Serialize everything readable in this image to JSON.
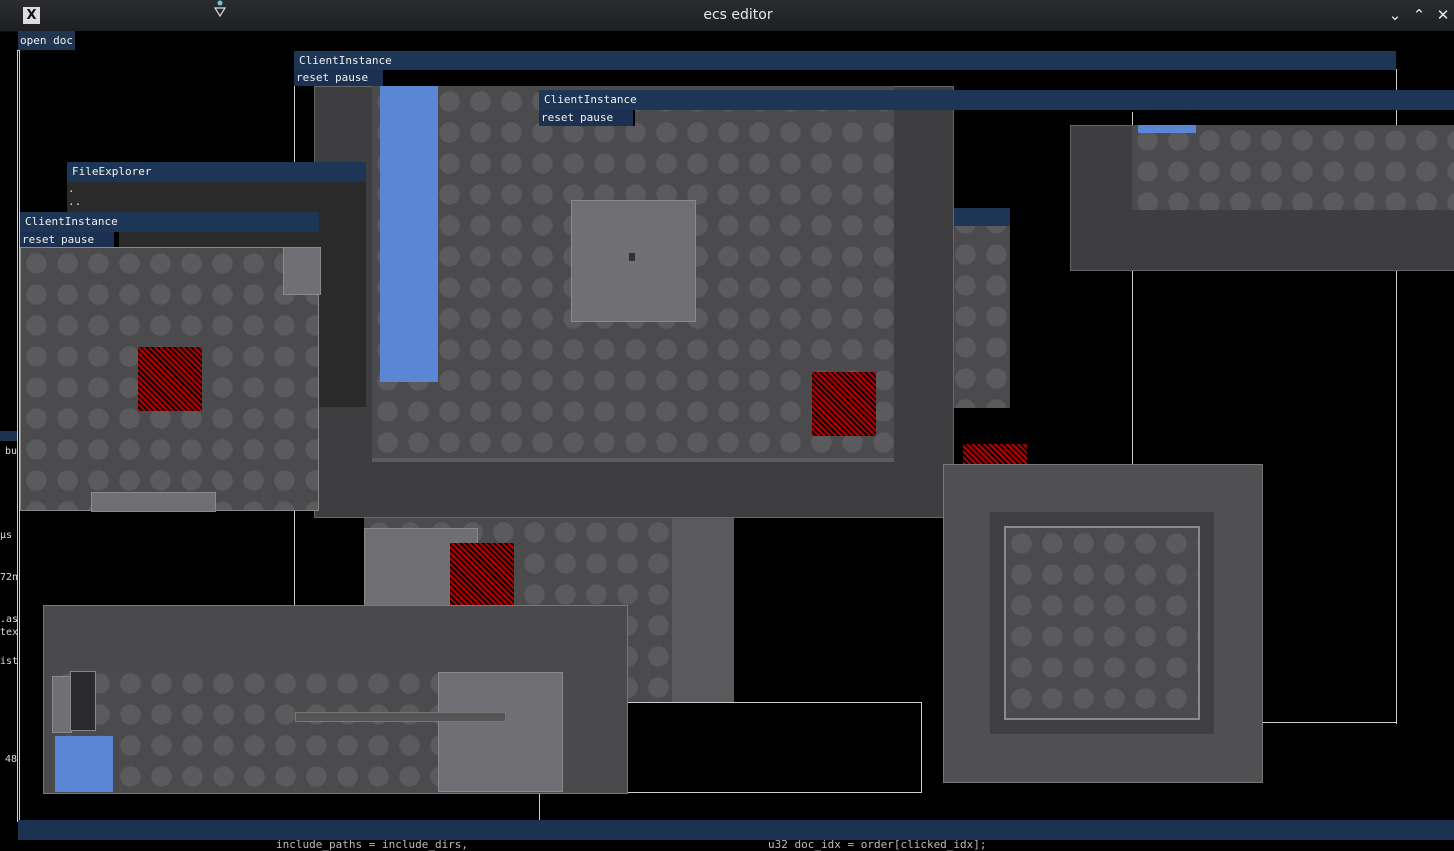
{
  "window": {
    "title": "ecs editor",
    "app_icon_glyph": "X",
    "buttons": {
      "minimize": "⌄",
      "maximize": "⌃",
      "close": "✕"
    }
  },
  "menu": {
    "open_doc": "open doc"
  },
  "windows": {
    "client1": {
      "title": "ClientInstance",
      "reset": "reset",
      "pause": "pause"
    },
    "client2": {
      "title": "ClientInstance",
      "reset": "reset",
      "pause": "pause"
    },
    "client3": {
      "title": "ClientInstance",
      "reset": "reset",
      "pause": "pause"
    },
    "file_explorer": {
      "title": "FileExplorer",
      "items": [
        ".",
        ".."
      ]
    }
  },
  "side_fragments": [
    "bu",
    "µs",
    "72n",
    ".as",
    "tex",
    "ist",
    "48"
  ],
  "bottom_code": {
    "left": "include_paths = include_dirs,",
    "right": "u32 doc_idx = order[clicked_idx];"
  },
  "colors": {
    "title_bar": "#1e3656",
    "button": "#1c3152",
    "floor": "#4b4b4d",
    "hazard": "#b30000",
    "blue_object": "#5b86d6"
  }
}
